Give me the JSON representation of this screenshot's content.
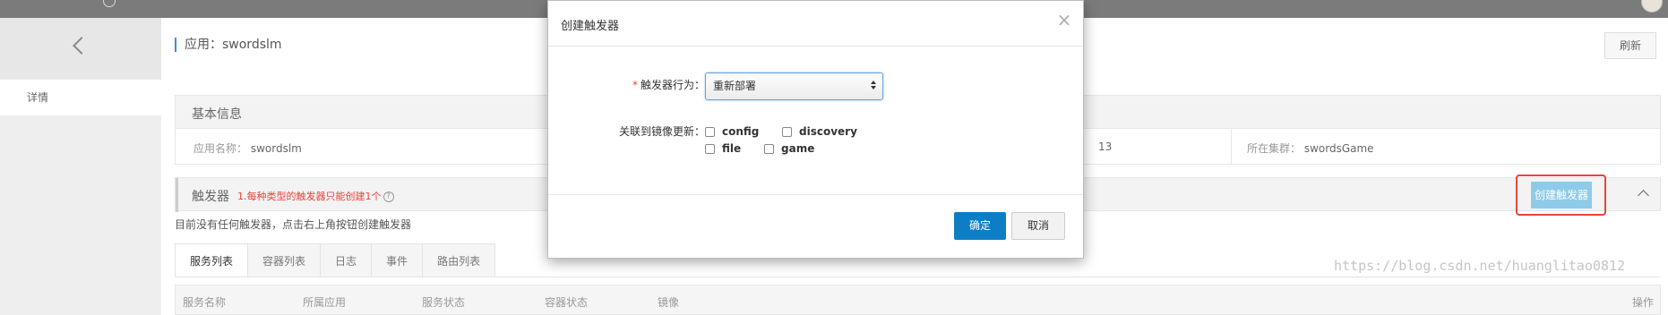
{
  "main": {
    "app_title": "应用：swordslm",
    "refresh_label": "刷新",
    "nav_detail": "详情"
  },
  "basic_info": {
    "title": "基本信息",
    "app_name_label": "应用名称：",
    "app_name_value": "swordslm",
    "partial_value": "13",
    "cluster_label": "所在集群：",
    "cluster_value": "swordsGame"
  },
  "triggers": {
    "title": "触发器",
    "note": "1.每种类型的触发器只能创建1个",
    "help_glyph": "?",
    "create_label": "创建触发器",
    "empty_message": "目前没有任何触发器，点击右上角按钮创建触发器"
  },
  "tabs": [
    "服务列表",
    "容器列表",
    "日志",
    "事件",
    "路由列表"
  ],
  "table_headers": {
    "service_name": "服务名称",
    "app": "所属应用",
    "service_status": "服务状态",
    "container_status": "容器状态",
    "image": "镜像",
    "ops": "操作"
  },
  "modal": {
    "title": "创建触发器",
    "close_glyph": "×",
    "action_label": "触发器行为：",
    "required_mark": "*",
    "action_value": "重新部署",
    "link_label": "关联到镜像更新：",
    "images": [
      "config",
      "discovery",
      "file",
      "game"
    ],
    "ok_label": "确定",
    "cancel_label": "取消"
  },
  "watermark": "https://blog.csdn.net/huanglitao0812",
  "colors": {
    "primary": "#0d7ec6",
    "create_button": "#8fcbe8",
    "highlight_border": "#e8443a",
    "note_red": "#e8443a",
    "topbar": "#7b7b7b"
  }
}
